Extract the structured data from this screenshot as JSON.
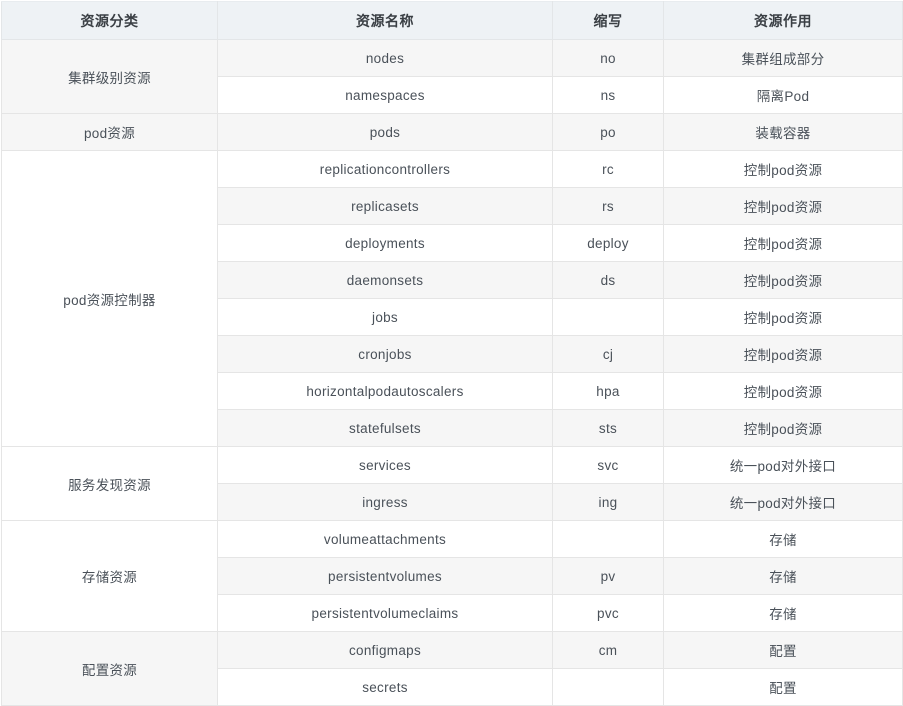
{
  "table": {
    "columns": [
      {
        "key": "category",
        "label": "资源分类"
      },
      {
        "key": "name",
        "label": "资源名称"
      },
      {
        "key": "abbr",
        "label": "缩写"
      },
      {
        "key": "role",
        "label": "资源作用"
      }
    ],
    "groups": [
      {
        "category": "集群级别资源",
        "rows": [
          {
            "name": "nodes",
            "abbr": "no",
            "role": "集群组成部分"
          },
          {
            "name": "namespaces",
            "abbr": "ns",
            "role": "隔离Pod"
          }
        ]
      },
      {
        "category": "pod资源",
        "rows": [
          {
            "name": "pods",
            "abbr": "po",
            "role": "装载容器"
          }
        ]
      },
      {
        "category": "pod资源控制器",
        "rows": [
          {
            "name": "replicationcontrollers",
            "abbr": "rc",
            "role": "控制pod资源"
          },
          {
            "name": "replicasets",
            "abbr": "rs",
            "role": "控制pod资源"
          },
          {
            "name": "deployments",
            "abbr": "deploy",
            "role": "控制pod资源"
          },
          {
            "name": "daemonsets",
            "abbr": "ds",
            "role": "控制pod资源"
          },
          {
            "name": "jobs",
            "abbr": "",
            "role": "控制pod资源"
          },
          {
            "name": "cronjobs",
            "abbr": "cj",
            "role": "控制pod资源"
          },
          {
            "name": "horizontalpodautoscalers",
            "abbr": "hpa",
            "role": "控制pod资源"
          },
          {
            "name": "statefulsets",
            "abbr": "sts",
            "role": "控制pod资源"
          }
        ]
      },
      {
        "category": "服务发现资源",
        "rows": [
          {
            "name": "services",
            "abbr": "svc",
            "role": "统一pod对外接口"
          },
          {
            "name": "ingress",
            "abbr": "ing",
            "role": "统一pod对外接口"
          }
        ]
      },
      {
        "category": "存储资源",
        "rows": [
          {
            "name": "volumeattachments",
            "abbr": "",
            "role": "存储"
          },
          {
            "name": "persistentvolumes",
            "abbr": "pv",
            "role": "存储"
          },
          {
            "name": "persistentvolumeclaims",
            "abbr": "pvc",
            "role": "存储"
          }
        ]
      },
      {
        "category": "配置资源",
        "rows": [
          {
            "name": "configmaps",
            "abbr": "cm",
            "role": "配置"
          },
          {
            "name": "secrets",
            "abbr": "",
            "role": "配置"
          }
        ]
      }
    ]
  },
  "colors": {
    "header_bg": "#eef2f5",
    "zebra_row_bg": "#f6f6f6",
    "plain_row_bg": "#ffffff",
    "border": "#e5e5e5",
    "text": "#4a5159",
    "header_text": "#3a3f44"
  }
}
